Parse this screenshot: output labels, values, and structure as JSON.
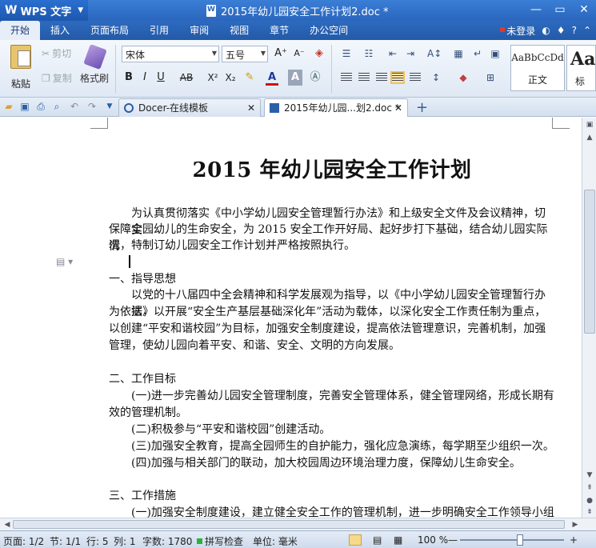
{
  "titlebar": {
    "app_logo": "W",
    "app_name": "WPS 文字",
    "doc_title": "2015年幼儿园安全工作计划2.doc *",
    "min": "—",
    "restore": "▭",
    "close": "✕"
  },
  "ribbon_tabs": [
    "开始",
    "插入",
    "页面布局",
    "引用",
    "审阅",
    "视图",
    "章节",
    "办公空间"
  ],
  "account": {
    "label": "未登录"
  },
  "clipboard": {
    "paste": "粘贴",
    "cut": "剪切",
    "copy": "复制",
    "format_painter": "格式刷"
  },
  "font": {
    "family": "宋体",
    "size": "五号",
    "bold": "B",
    "italic": "I",
    "underline": "U",
    "strike": "AB",
    "sup": "X²",
    "sub": "X₂",
    "grow": "A⁺",
    "shrink": "A⁻",
    "color_a": "A"
  },
  "styles": {
    "sample": "AaBbCcDd",
    "name": "正文",
    "sample2": "Aa",
    "name2": "标"
  },
  "doc_tabs": [
    {
      "label": "Docer-在线模板",
      "close": "✕"
    },
    {
      "label": "2015年幼儿园...划2.doc *",
      "close": "✕"
    }
  ],
  "add_tab": "+",
  "document": {
    "title": "2015 年幼儿园安全工作计划",
    "intro_1": "为认真贯彻落实《中小学幼儿园安全管理暂行办法》和上级安全文件及会议精神，切实",
    "intro_2": "保障全园幼儿的生命安全，为 2015 安全工作开好局、起好步打下基础，结合幼儿园实际情",
    "intro_3": "况，特制订幼儿园安全工作计划并严格按照执行。",
    "s1_head": "一、指导思想",
    "s1_1": "以党的十八届四中全会精神和科学发展观为指导，以《中小学幼儿园安全管理暂行办法》",
    "s1_2": "为依据，以开展“安全生产基层基础深化年”活动为载体，以深化安全工作责任制为重点，",
    "s1_3": "以创建“平安和谐校园”为目标，加强安全制度建设，提高依法管理意识，完善机制，加强",
    "s1_4": "管理，使幼儿园向着平安、和谐、安全、文明的方向发展。",
    "s2_head": "二、工作目标",
    "s2_1": "(一)进一步完善幼儿园安全管理制度，完善安全管理体系，健全管理网络，形成长期有",
    "s2_2": "效的管理机制。",
    "s2_3": "(二)积极参与“平安和谐校园”创建活动。",
    "s2_4": "(三)加强安全教育，提高全园师生的自护能力，强化应急演练，每学期至少组织一次。",
    "s2_5": "(四)加强与相关部门的联动，加大校园周边环境治理力度，保障幼儿生命安全。",
    "s3_head": "三、工作措施",
    "s3_1": "(一)加强安全制度建设，建立健全安全工作的管理机制，进一步明确安全工作领导小组"
  },
  "statusbar": {
    "page": "页面: 1/2",
    "section": "节: 1/1",
    "line": "行: 5",
    "col": "列: 1",
    "words": "字数: 1780",
    "spell": "拼写检查",
    "unit": "单位: 毫米",
    "zoom": "100 %",
    "zoom_minus": "—",
    "zoom_plus": "+"
  }
}
